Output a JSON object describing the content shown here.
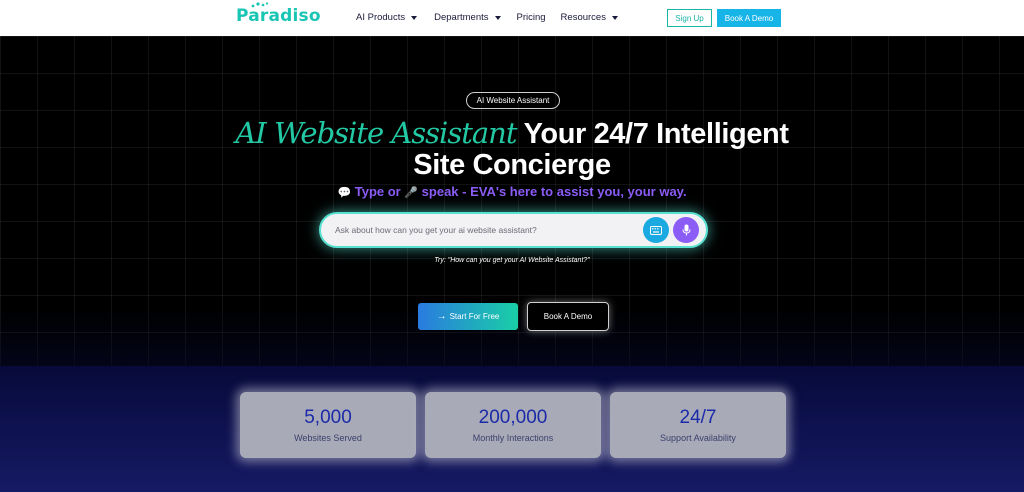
{
  "nav": {
    "logo": "Paradiso",
    "menu": [
      {
        "label": "AI Products",
        "has_dropdown": true
      },
      {
        "label": "Departments",
        "has_dropdown": true
      },
      {
        "label": "Pricing",
        "has_dropdown": false
      },
      {
        "label": "Resources",
        "has_dropdown": true
      }
    ],
    "signup_label": "Sign Up",
    "book_demo_label": "Book A Demo"
  },
  "hero": {
    "pill_label": "AI Website Assistant",
    "headline_accent": "AI Website Assistant",
    "headline_rest_l1": " Your 24/7 Intelligent",
    "headline_l2": "Site Concierge",
    "sub_emoji_1": "💬",
    "sub_part_1": " Type or ",
    "sub_emoji_2": "🎤",
    "sub_part_2": " speak - EVA's here to assist you, your way.",
    "search_placeholder": "Ask about how can you get your ai website assistant?",
    "try_text": "Try: \"How can you get your AI Website Assistant?\"",
    "start_label": "Start For Free",
    "start_icon": "arrow-right-icon",
    "book_label": "Book A Demo"
  },
  "stats": [
    {
      "value": "5,000",
      "label": "Websites Served"
    },
    {
      "value": "200,000",
      "label": "Monthly Interactions"
    },
    {
      "value": "24/7",
      "label": "Support Availability"
    }
  ],
  "colors": {
    "accent_teal": "#22c9a4",
    "accent_purple": "#8b5cf6",
    "nav_demo_blue": "#17b4e8",
    "stat_number": "#1a2aa8"
  }
}
